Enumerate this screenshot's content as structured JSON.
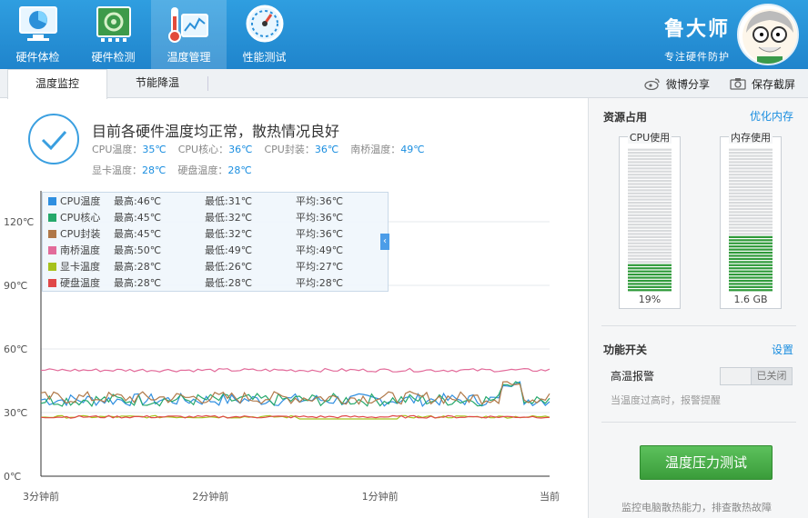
{
  "nav": {
    "items": [
      {
        "label": "硬件体检",
        "icon": "monitor-check-icon"
      },
      {
        "label": "硬件检测",
        "icon": "circuit-board-icon"
      },
      {
        "label": "温度管理",
        "icon": "thermometer-icon"
      },
      {
        "label": "性能测试",
        "icon": "speedometer-icon"
      }
    ],
    "active": "温度管理"
  },
  "brand": {
    "name": "鲁大师",
    "slogan": "专注硬件防护"
  },
  "subbar": {
    "tabs": [
      {
        "label": "温度监控"
      },
      {
        "label": "节能降温"
      }
    ],
    "actions": {
      "weibo": "微博分享",
      "screenshot": "保存截屏"
    }
  },
  "status": {
    "title": "目前各硬件温度均正常，散热情况良好",
    "readings": [
      {
        "label": "CPU温度：",
        "value": "35℃"
      },
      {
        "label": "CPU核心：",
        "value": "36℃"
      },
      {
        "label": "CPU封装：",
        "value": "36℃"
      },
      {
        "label": "南桥温度：",
        "value": "49℃"
      },
      {
        "label": "显卡温度：",
        "value": "28℃"
      },
      {
        "label": "硬盘温度：",
        "value": "28℃"
      }
    ]
  },
  "chart_data": {
    "type": "line",
    "x_ticks": [
      "3分钟前",
      "2分钟前",
      "1分钟前",
      "当前"
    ],
    "y_ticks": [
      "0℃",
      "30℃",
      "60℃",
      "90℃",
      "120℃"
    ],
    "ylim": [
      0,
      120
    ],
    "grid": true,
    "legend_placement": "top-left",
    "series": [
      {
        "name": "CPU温度",
        "color": "#2f8fe0",
        "max": "最高:46℃",
        "min": "最低:31℃",
        "avg": "平均:36℃",
        "base": 36
      },
      {
        "name": "CPU核心",
        "color": "#25a86b",
        "max": "最高:45℃",
        "min": "最低:32℃",
        "avg": "平均:36℃",
        "base": 36
      },
      {
        "name": "CPU封装",
        "color": "#b07848",
        "max": "最高:45℃",
        "min": "最低:32℃",
        "avg": "平均:36℃",
        "base": 37
      },
      {
        "name": "南桥温度",
        "color": "#e26b9a",
        "max": "最高:50℃",
        "min": "最低:49℃",
        "avg": "平均:49℃",
        "base": 50
      },
      {
        "name": "显卡温度",
        "color": "#a6c21c",
        "max": "最高:28℃",
        "min": "最低:26℃",
        "avg": "平均:27℃",
        "base": 28
      },
      {
        "name": "硬盘温度",
        "color": "#e04848",
        "max": "最高:28℃",
        "min": "最低:28℃",
        "avg": "平均:28℃",
        "base": 28
      }
    ]
  },
  "resources": {
    "title": "资源占用",
    "optimize": "优化内存",
    "cpu": {
      "label": "CPU使用",
      "value": "19%",
      "fraction": 0.19,
      "color": "#2f9a3a"
    },
    "memory": {
      "label": "内存使用",
      "value": "1.6 GB",
      "fraction": 0.4,
      "color": "#2f9a3a"
    }
  },
  "functions": {
    "title": "功能开关",
    "settings": "设置",
    "alarm_label": "高温报警",
    "alarm_state": "已关闭",
    "alarm_desc": "当温度过高时，报警提醒"
  },
  "stress": {
    "button": "温度压力测试",
    "desc": "监控电脑散热能力，排查散热故障"
  }
}
